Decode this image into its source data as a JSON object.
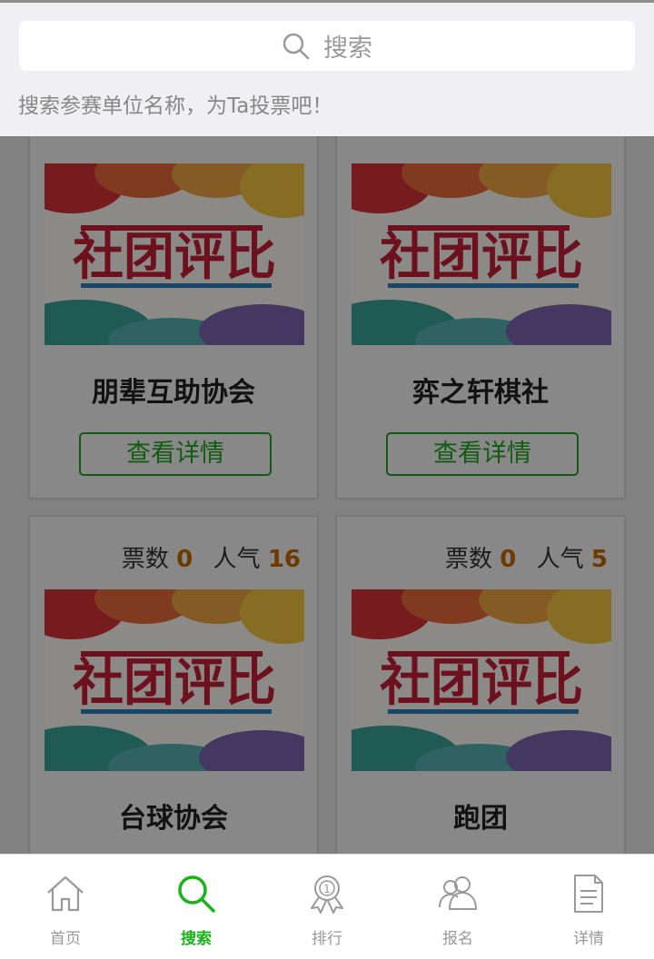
{
  "search": {
    "placeholder": "搜索",
    "tip": "搜索参赛单位名称，为Ta投票吧！"
  },
  "cards": [
    {
      "name": "朋辈互助协会",
      "button": "查看详情"
    },
    {
      "name": "弈之轩棋社",
      "button": "查看详情"
    },
    {
      "name": "台球协会",
      "stats_votes_label": "票数",
      "votes": "0",
      "stats_pop_label": "人气",
      "popularity": "16"
    },
    {
      "name": "跑团",
      "stats_votes_label": "票数",
      "votes": "0",
      "stats_pop_label": "人气",
      "popularity": "5"
    }
  ],
  "poster_text": "社团评比",
  "tabs": [
    {
      "label": "首页",
      "icon": "home-icon"
    },
    {
      "label": "搜索",
      "icon": "search-icon"
    },
    {
      "label": "排行",
      "icon": "medal-icon"
    },
    {
      "label": "报名",
      "icon": "users-icon"
    },
    {
      "label": "详情",
      "icon": "document-icon"
    }
  ],
  "colors": {
    "accent": "#18b418",
    "number": "#c76a00"
  }
}
